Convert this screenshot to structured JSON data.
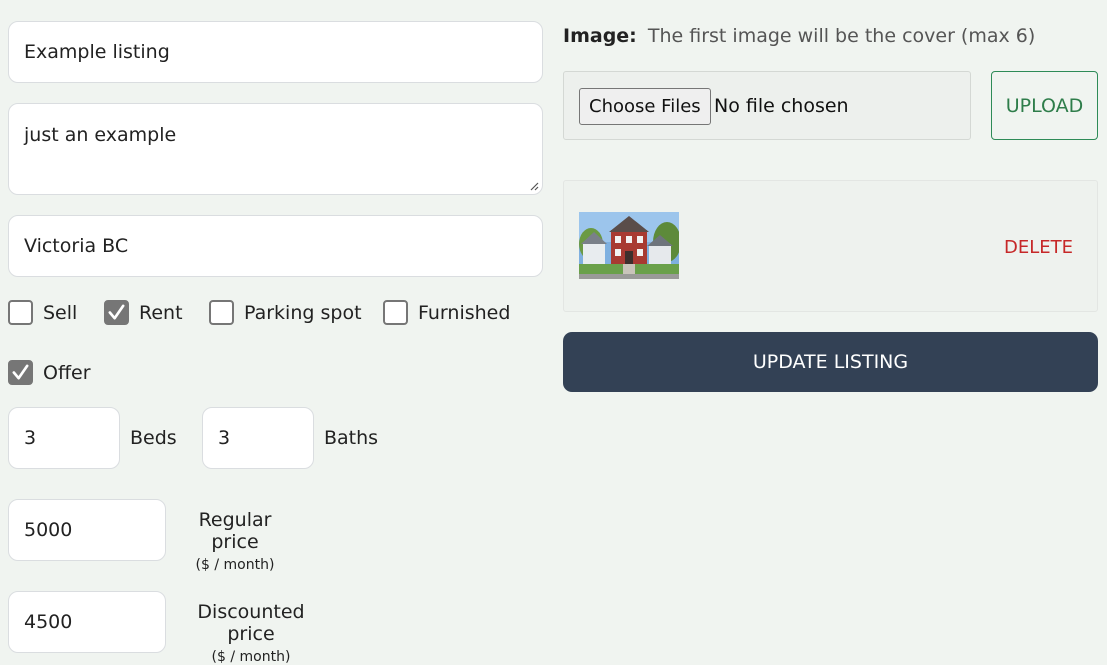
{
  "form": {
    "name_value": "Example listing",
    "description_value": "just an example",
    "address_value": "Victoria BC",
    "checkboxes": [
      {
        "label": "Sell",
        "checked": false
      },
      {
        "label": "Rent",
        "checked": true
      },
      {
        "label": "Parking spot",
        "checked": false
      },
      {
        "label": "Furnished",
        "checked": false
      },
      {
        "label": "Offer",
        "checked": true
      }
    ],
    "beds": {
      "value": "3",
      "label": "Beds"
    },
    "baths": {
      "value": "3",
      "label": "Baths"
    },
    "regular_price": {
      "value": "5000",
      "label": "Regular price",
      "unit": "($ / month)"
    },
    "discounted_price": {
      "value": "4500",
      "label": "Discounted price",
      "unit": "($ / month)"
    }
  },
  "images": {
    "label": "Image:",
    "hint": "The first image will be the cover (max 6)",
    "choose_files_label": "Choose Files",
    "no_file_text": "No file chosen",
    "upload_label": "UPLOAD",
    "delete_label": "DELETE",
    "thumbnail": "house-photo"
  },
  "submit": {
    "label": "UPDATE LISTING"
  },
  "colors": {
    "background": "#f0f4f0",
    "update_button": "#334155",
    "upload_accent": "#2e7d4a",
    "delete_accent": "#c62828",
    "checkbox_checked": "#767676"
  }
}
